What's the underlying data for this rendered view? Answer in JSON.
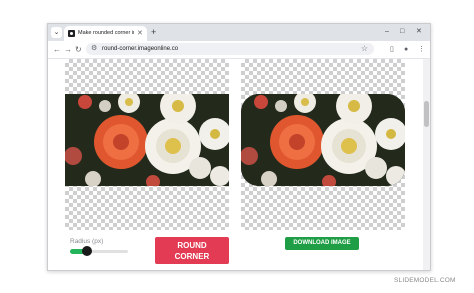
{
  "browser": {
    "tab_title": "Make rounded corner image o",
    "new_tab_icon": "plus-icon",
    "url": "round-corner.imageonline.co",
    "window_controls": {
      "minimize": "–",
      "maximize": "□",
      "close": "✕"
    }
  },
  "tool": {
    "radius_label": "Radius (px)",
    "radius_value_fraction": 0.3,
    "round_button_line1": "ROUND",
    "round_button_line2": "CORNER",
    "download_button": "DOWNLOAD IMAGE"
  },
  "colors": {
    "round_button": "#e23b53",
    "download_button": "#1f9e45",
    "slider_fill": "#23b45c"
  },
  "watermark": "SLIDEMODEL.COM"
}
